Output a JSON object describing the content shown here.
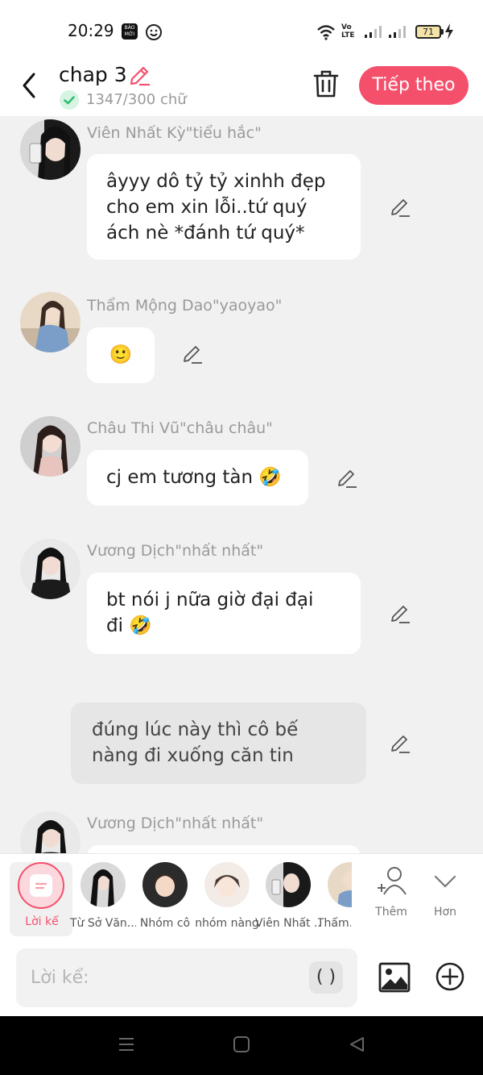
{
  "status_bar": {
    "time": "20:29",
    "news_badge": "BÁO MỚI",
    "volte_label": "Vo LTE",
    "battery": "71"
  },
  "header": {
    "title": "chap 3",
    "word_count": "1347/300 chữ",
    "next_label": "Tiếp theo"
  },
  "messages": [
    {
      "sender": "Viên Nhất Kỳ\"tiểu hắc\"",
      "lines": [
        "âyyy dô tỷ tỷ xinhh đẹp",
        "cho em xin lỗi..tứ quý",
        "ách nè *đánh tứ quý*"
      ]
    },
    {
      "sender": "Thẩm Mộng Dao\"yaoyao\"",
      "lines": [
        "🙂"
      ]
    },
    {
      "sender": "Châu Thi Vũ\"châu châu\"",
      "lines": [
        "cj em tương tàn 🤣"
      ]
    },
    {
      "sender": "Vương Dịch\"nhất nhất\"",
      "lines": [
        "bt nói j nữa giờ đại đại",
        "đi 🤣"
      ]
    },
    {
      "sender": "Vương Dịch\"nhất nhất\"",
      "lines": []
    }
  ],
  "narration": {
    "lines": [
      "đúng lúc này thì cô bế",
      "nàng đi xuống căn tin"
    ]
  },
  "character_bar": {
    "narrator_label": "Lời kể",
    "characters": [
      "Từ Sở Văn...",
      "Nhóm cô",
      "nhóm nàng",
      "Viên Nhất ...",
      "Thẩm..."
    ],
    "more_label": "Thêm",
    "expand_label": "Hơn"
  },
  "input": {
    "placeholder": "Lời kể:",
    "paren_label": "( )"
  },
  "colors": {
    "accent": "#f4506c",
    "success": "#2fbf71"
  }
}
